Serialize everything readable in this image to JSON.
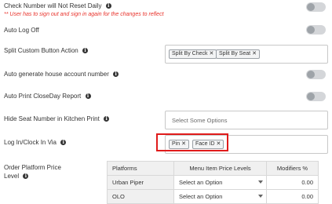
{
  "settings": {
    "check_number_reset": {
      "label": "Check Number will Not Reset Daily",
      "warning": "** User has to sign out and sign in again for the changes to reflect"
    },
    "auto_log_off": {
      "label": "Auto Log Off"
    },
    "split_custom_button_action": {
      "label": "Split Custom Button Action",
      "chips": [
        "Split By Check",
        "Split By Seat"
      ]
    },
    "auto_generate_house_account_number": {
      "label": "Auto generate house account number"
    },
    "auto_print_closeday_report": {
      "label": "Auto Print CloseDay Report"
    },
    "hide_seat_number": {
      "label": "Hide Seat Number in Kitchen Print",
      "placeholder": "Select Some Options"
    },
    "log_in_clock_in_via": {
      "label": "Log In/Clock In Via",
      "chips": [
        "Pin",
        "Face ID"
      ]
    },
    "order_platform_price_level": {
      "label_line1": "Order Platform Price",
      "label_line2": "Level",
      "headers": [
        "Platforms",
        "Menu Item Price Levels",
        "Modifiers %"
      ],
      "rows": [
        {
          "platform": "Urban Piper",
          "price_level": "Select an Option",
          "modifiers": "0.00"
        },
        {
          "platform": "OLO",
          "price_level": "Select an Option",
          "modifiers": "0.00"
        }
      ]
    }
  },
  "icons": {
    "info": "info-icon",
    "remove_chip": "close-icon",
    "dropdown": "chevron-down-icon"
  },
  "colors": {
    "warning": "#e8322b",
    "highlight_box": "#e01b1b",
    "toggle_off": "#d4d6d9"
  }
}
